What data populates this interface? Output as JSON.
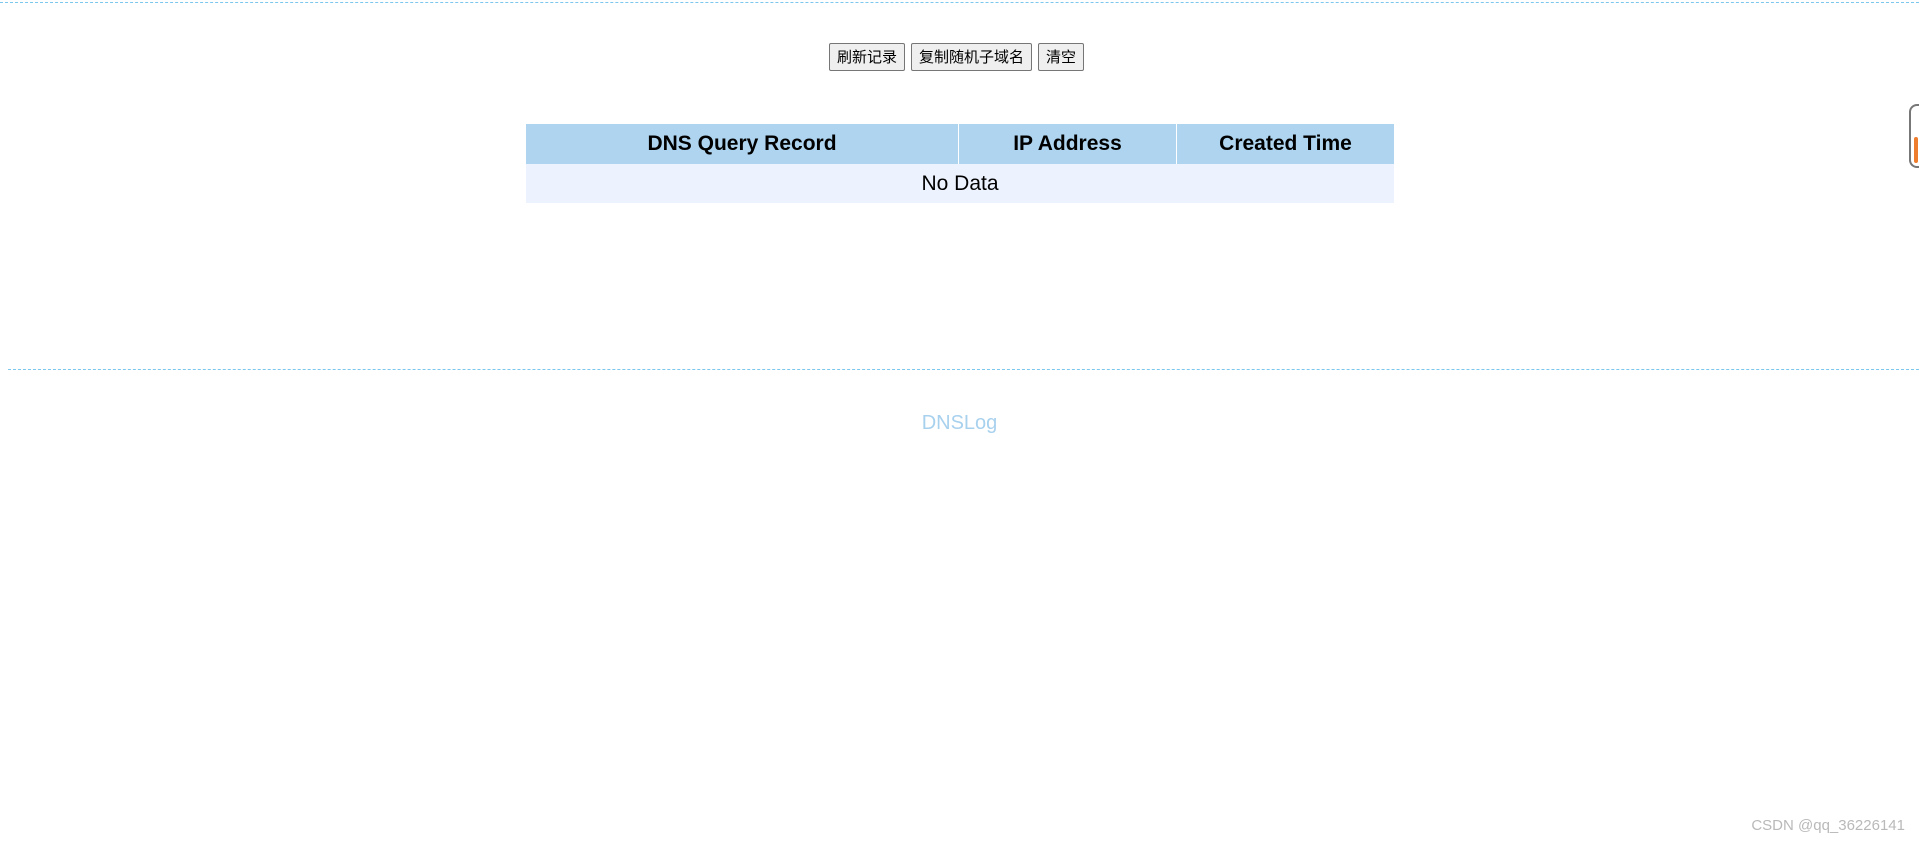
{
  "toolbar": {
    "refresh_label": "刷新记录",
    "copy_label": "复制随机子域名",
    "clear_label": "清空"
  },
  "table": {
    "headers": [
      "DNS Query Record",
      "IP Address",
      "Created Time"
    ],
    "empty_text": "No Data"
  },
  "footer": {
    "brand": "DNSLog"
  },
  "watermark": "CSDN @qq_36226141",
  "colors": {
    "dash_line": "#7cc7ee",
    "header_bg": "#aed4ef",
    "row_bg": "#edf3fe",
    "brand_text": "#a8d1ee",
    "scroll_accent": "#ef7d2e"
  },
  "scroll_position": 0.6
}
